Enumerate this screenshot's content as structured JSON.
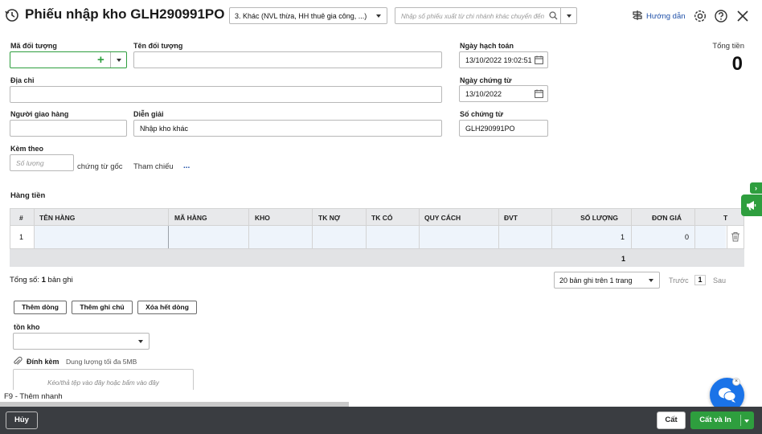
{
  "header": {
    "title": "Phiếu nhập kho GLH290991PO",
    "type_select": "3. Khác (NVL thừa, HH thuê gia công, ...)",
    "search_placeholder": "Nhập số phiếu xuất từ chi nhánh khác chuyển đến",
    "guide_label": "Hướng dẫn"
  },
  "form": {
    "ma_doi_tuong_label": "Mã đối tượng",
    "ten_doi_tuong_label": "Tên đối tượng",
    "dia_chi_label": "Địa chỉ",
    "nguoi_giao_hang_label": "Người giao hàng",
    "dien_giai_label": "Diễn giải",
    "dien_giai_value": "Nhập kho khác",
    "kem_theo_label": "Kèm theo",
    "so_luong_placeholder": "Số lượng",
    "chung_tu_goc": "chứng từ gốc",
    "tham_chieu": "Tham chiếu",
    "tham_chieu_more": "...",
    "ngay_hach_toan_label": "Ngày hạch toán",
    "ngay_hach_toan_value": "13/10/2022 19:02:51",
    "ngay_chung_tu_label": "Ngày chứng từ",
    "ngay_chung_tu_value": "13/10/2022",
    "so_chung_tu_label": "Số chứng từ",
    "so_chung_tu_value": "GLH290991PO",
    "tong_tien_label": "Tổng tiền",
    "tong_tien_value": "0"
  },
  "table": {
    "section_title": "Hàng tiền",
    "columns": [
      "#",
      "TÊN HÀNG",
      "MÃ HÀNG",
      "KHO",
      "TK NỢ",
      "TK CÓ",
      "QUY CÁCH",
      "ĐVT",
      "SỐ LƯỢNG",
      "ĐƠN GIÁ",
      "T"
    ],
    "rows": [
      {
        "index": "1",
        "ten_hang": "",
        "ma_hang": "",
        "kho": "",
        "tk_no": "",
        "tk_co": "",
        "quy_cach": "",
        "dvt": "",
        "so_luong": "1",
        "don_gia": "0"
      }
    ],
    "footer_so_luong": "1",
    "total_label": "Tổng số: ",
    "total_count": "1",
    "total_suffix": " bản ghi",
    "page_size": "20 bản ghi trên 1 trang",
    "prev": "Trước",
    "page": "1",
    "next": "Sau"
  },
  "actions": {
    "add_row": "Thêm dòng",
    "add_note": "Thêm ghi chú",
    "delete_all": "Xóa hết dòng"
  },
  "ton_kho": {
    "label": "tồn kho",
    "value": ""
  },
  "attachment": {
    "label": "Đính kèm",
    "limit": "Dung lượng tối đa 5MB",
    "drop_hint": "Kéo/thả tệp vào đây hoặc bấm vào đây"
  },
  "shortcut_hint": "F9 - Thêm nhanh",
  "footer": {
    "cancel": "Hủy",
    "save": "Cất",
    "save_print": "Cất và In"
  },
  "colors": {
    "primary_green": "#2e9e3e",
    "footer_bg": "#3a3d41",
    "link_blue": "#1e4fa8",
    "chat_blue": "#1a73e8"
  }
}
